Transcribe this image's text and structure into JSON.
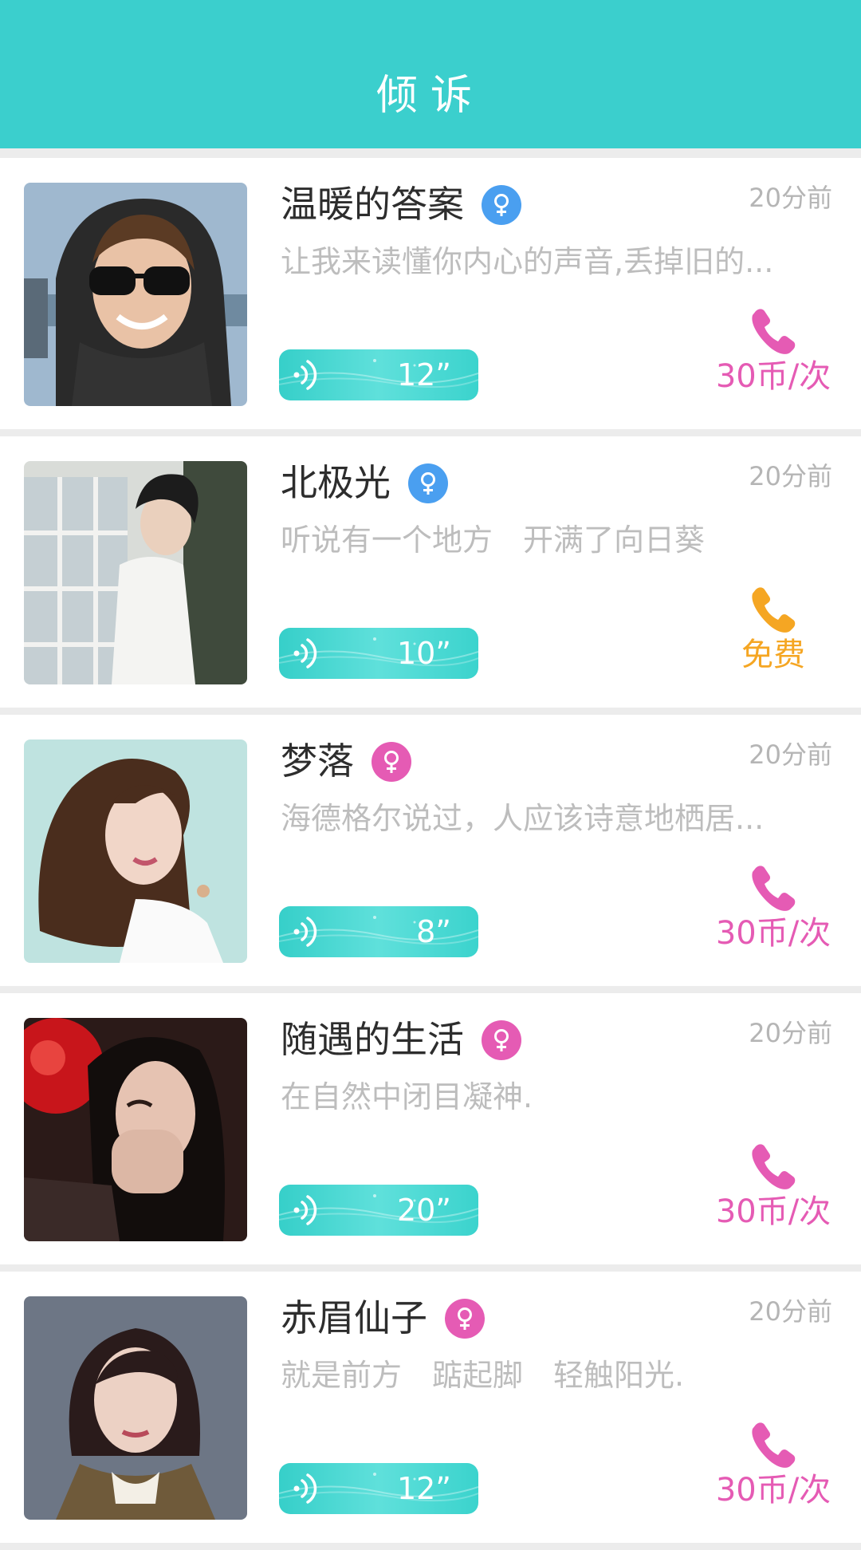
{
  "header": {
    "title": "倾诉"
  },
  "colors": {
    "header_bg": "#3bcfcd",
    "male": "#4a9ff0",
    "female": "#e55bb4",
    "price_paid": "#e55bb4",
    "price_free": "#f5a623",
    "voice_bg": "#3ed1cb"
  },
  "items": [
    {
      "name": "温暖的答案",
      "gender_icon": "venus-icon",
      "gender_color": "#4a9ff0",
      "time": "20分前",
      "desc": "让我来读懂你内心的声音,丢掉旧的...",
      "voice_length": "12”",
      "price": "30币/次",
      "price_color": "#e55bb4"
    },
    {
      "name": "北极光",
      "gender_icon": "venus-icon",
      "gender_color": "#4a9ff0",
      "time": "20分前",
      "desc": "听说有一个地方　开满了向日葵",
      "voice_length": "10”",
      "price": "免费",
      "price_color": "#f5a623"
    },
    {
      "name": "梦落",
      "gender_icon": "venus-icon",
      "gender_color": "#e55bb4",
      "time": "20分前",
      "desc": "海德格尔说过，人应该诗意地栖居...",
      "voice_length": "8”",
      "price": "30币/次",
      "price_color": "#e55bb4"
    },
    {
      "name": "随遇的生活",
      "gender_icon": "venus-icon",
      "gender_color": "#e55bb4",
      "time": "20分前",
      "desc": "在自然中闭目凝神.",
      "voice_length": "20”",
      "price": "30币/次",
      "price_color": "#e55bb4"
    },
    {
      "name": "赤眉仙子",
      "gender_icon": "venus-icon",
      "gender_color": "#e55bb4",
      "time": "20分前",
      "desc": "就是前方　踮起脚　轻触阳光.",
      "voice_length": "12”",
      "price": "30币/次",
      "price_color": "#e55bb4"
    }
  ]
}
